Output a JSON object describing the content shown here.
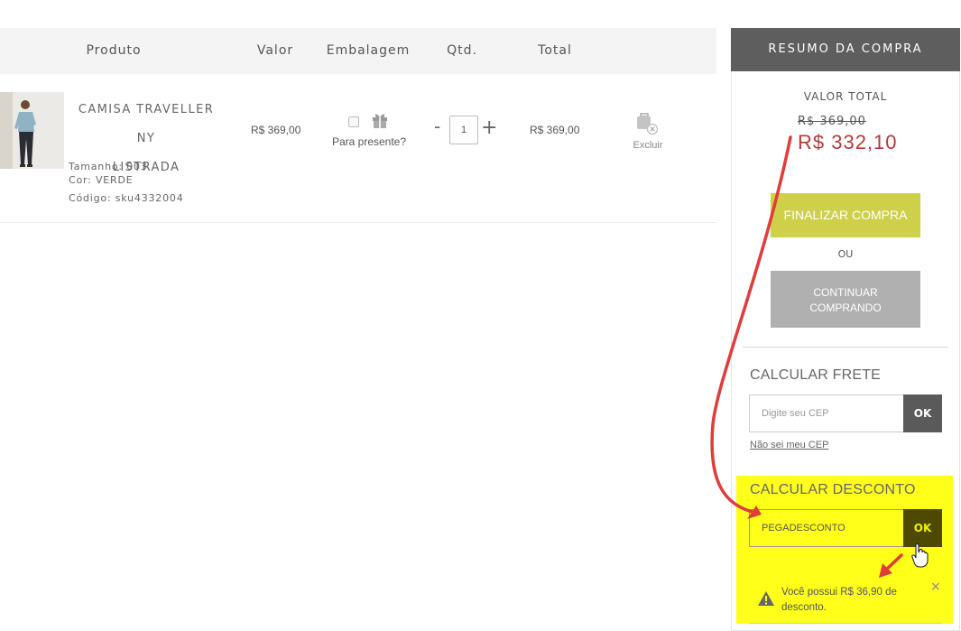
{
  "cart": {
    "headers": {
      "produto": "Produto",
      "valor": "Valor",
      "embalagem": "Embalagem",
      "qtd": "Qtd.",
      "total": "Total"
    },
    "item": {
      "name_line1": "CAMISA TRAVELLER NY",
      "name_line2": "LISTRADA",
      "tamanho": "Tamanho: 003",
      "cor": "Cor: VERDE",
      "codigo": "Código: sku4332004",
      "valor": "R$ 369,00",
      "gift_label": "Para presente?",
      "gift_checked": false,
      "qty": "1",
      "qty_minus": "-",
      "qty_plus": "+",
      "total": "R$ 369,00",
      "delete_label": "Excluir"
    }
  },
  "summary": {
    "title": "RESUMO DA COMPRA",
    "valor_total_label": "VALOR TOTAL",
    "old_price": "R$ 369,00",
    "new_price": "R$ 332,10",
    "finalizar_label": "FINALIZAR COMPRA",
    "ou_label": "OU",
    "continuar_line1": "CONTINUAR",
    "continuar_line2": "COMPRANDO"
  },
  "frete": {
    "title": "CALCULAR FRETE",
    "placeholder": "Digite seu CEP",
    "ok_label": "OK",
    "link_label": "Não sei meu CEP"
  },
  "desconto": {
    "title": "CALCULAR DESCONTO",
    "value": "PEGADESCONTO",
    "ok_label": "OK",
    "alert_text": "Você possui R$ 36,90 de desconto.",
    "close_symbol": "×"
  },
  "colors": {
    "accent_green": "#cfd04a",
    "price_red": "#b23a3a",
    "highlight_yellow": "#ffff1a",
    "arrow_red": "#e03c3c",
    "header_gray": "#5e5e5e"
  },
  "icons": [
    "gift-icon",
    "bag-remove-icon",
    "warning-icon",
    "close-icon",
    "hand-pointer-icon",
    "annotation-arrow"
  ]
}
